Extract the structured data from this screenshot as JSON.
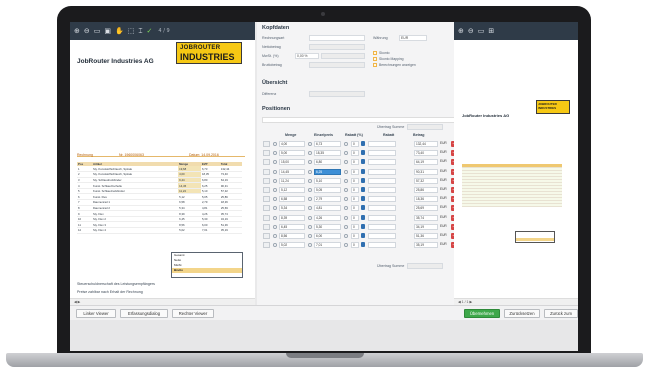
{
  "left_viewer": {
    "toolbar": {
      "icons": [
        "zoom-in-icon",
        "zoom-out-icon",
        "page-icon",
        "page-icon",
        "hand-icon",
        "select-icon",
        "text-select-icon",
        "check-icon"
      ],
      "page_info": "4 / 9"
    },
    "logo": {
      "line1": "JOBROUTER",
      "line2": "INDUSTRIES"
    },
    "title": "JobRouter Industries AG",
    "invoice_label": "Rechnung",
    "invoice_no": "Nr. 1960006063",
    "invoice_date": "Datum: 14.09.2016",
    "columns": [
      "Pos",
      "Artikel",
      "Menge",
      "EVP",
      "Total"
    ],
    "rows": [
      [
        "1",
        "Sty. Kunststoffschlauch, Spirale",
        "19,68",
        "6,73",
        "132,44"
      ],
      [
        "2",
        "Sty. Kunststoffschlauch, Spirale",
        "4,00",
        "18,35",
        "73,40"
      ],
      [
        "3",
        "Sty. Schlaudruckbinder",
        "9,44",
        "6,80",
        "64,19"
      ],
      [
        "4",
        "Kunst. Schlauchschelle",
        "14,45",
        "6,25",
        "90,31"
      ],
      [
        "5",
        "Kunst. Schlaudruckbinder",
        "11,24",
        "5,10",
        "57,32"
      ],
      [
        "6",
        "Kunst. Flex",
        "5,12",
        "5,05",
        "25,86"
      ],
      [
        "7",
        "Daumenrad 1",
        "6,58",
        "2,79",
        "18,36"
      ],
      [
        "8",
        "Daumenrad 2",
        "5,34",
        "4,81",
        "25,69"
      ],
      [
        "9",
        "Sty. Flex",
        "8,39",
        "4,26",
        "35,74"
      ],
      [
        "10",
        "Sty. Flex 2",
        "6,45",
        "5,30",
        "34,19"
      ],
      [
        "11",
        "Sty. Flex 3",
        "8,56",
        "6,00",
        "51,36"
      ],
      [
        "12",
        "Sty. Flex 4",
        "5,02",
        "7,01",
        "35,19"
      ]
    ],
    "totals": [
      [
        "Gesamt",
        ""
      ],
      [
        "Netto",
        ""
      ],
      [
        "MwSt",
        ""
      ],
      [
        "Brutto",
        ""
      ]
    ],
    "footer_lines": [
      "Steuerschuldnerschaft des Leistungsempfängers",
      "Preise zahlbar nach Erhalt der Rechnung"
    ]
  },
  "form": {
    "section_header": "Kopfdaten",
    "fields": {
      "rechnungsart": {
        "label": "Rechnungsart",
        "value": ""
      },
      "netto": {
        "label": "Nettobetrag",
        "value": ""
      },
      "mwst": {
        "label": "MwSt. (%)",
        "value": "0,00 %"
      },
      "steuer": {
        "label": "Steuer",
        "value": ""
      },
      "brutto": {
        "label": "Bruttobetrag",
        "value": ""
      },
      "waehrung": {
        "label": "Währung",
        "value": "EUR"
      }
    },
    "checkboxes": [
      "Skonto",
      "Skonto Mapping",
      "Berechnungen anzeigen"
    ],
    "summary_header": "Übersicht",
    "summary_label": "Differenz",
    "positions_header": "Positionen",
    "columns": [
      "Menge",
      "Einzelpreis",
      "Rabatt (%)",
      "Rabatt",
      "Betrag"
    ],
    "rows": [
      {
        "menge": "4,00",
        "preis": "6,73",
        "rabatt": "0",
        "betrag": "132,44",
        "art": "EUR"
      },
      {
        "menge": "5,00",
        "preis": "18,35",
        "rabatt": "0",
        "betrag": "73,40",
        "art": "EUR"
      },
      {
        "menge": "15,00",
        "preis": "6,80",
        "rabatt": "0",
        "betrag": "64,19",
        "art": "EUR"
      },
      {
        "menge": "14,45",
        "preis": "6,25",
        "rabatt": "0",
        "betrag": "90,31",
        "art": "EUR",
        "highlight": true
      },
      {
        "menge": "11,24",
        "preis": "5,10",
        "rabatt": "0",
        "betrag": "57,32",
        "art": "EUR"
      },
      {
        "menge": "5,12",
        "preis": "5,05",
        "rabatt": "0",
        "betrag": "25,86",
        "art": "EUR"
      },
      {
        "menge": "6,58",
        "preis": "2,79",
        "rabatt": "0",
        "betrag": "18,36",
        "art": "EUR"
      },
      {
        "menge": "5,34",
        "preis": "4,81",
        "rabatt": "0",
        "betrag": "25,69",
        "art": "EUR"
      },
      {
        "menge": "8,39",
        "preis": "4,26",
        "rabatt": "0",
        "betrag": "35,74",
        "art": "EUR"
      },
      {
        "menge": "6,45",
        "preis": "5,30",
        "rabatt": "0",
        "betrag": "34,19",
        "art": "EUR"
      },
      {
        "menge": "8,56",
        "preis": "6,00",
        "rabatt": "0",
        "betrag": "51,36",
        "art": "EUR"
      },
      {
        "menge": "5,02",
        "preis": "7,01",
        "rabatt": "0",
        "betrag": "35,19",
        "art": "EUR"
      }
    ],
    "summe_label": "Übertrag Summe"
  },
  "right_viewer": {
    "toolbar": {
      "icons": [
        "zoom-in-icon",
        "zoom-out-icon",
        "page-icon",
        "grid-icon"
      ]
    },
    "logo": "JOBROUTER INDUSTRIES",
    "title": "JobRouter Industries AG",
    "pager": "1 / 1"
  },
  "footer": {
    "buttons": [
      "Linker Viewer",
      "Erfassungsdialog",
      "Rechter Viewer"
    ],
    "right_buttons": [
      "Übernehmen",
      "Zurücksetzen",
      "Zurück zum"
    ]
  },
  "colors": {
    "accent_green": "#3ea84a",
    "danger_red": "#d64545",
    "toolbar_dark": "#2f3b48",
    "logo_yellow": "#f6c814"
  }
}
